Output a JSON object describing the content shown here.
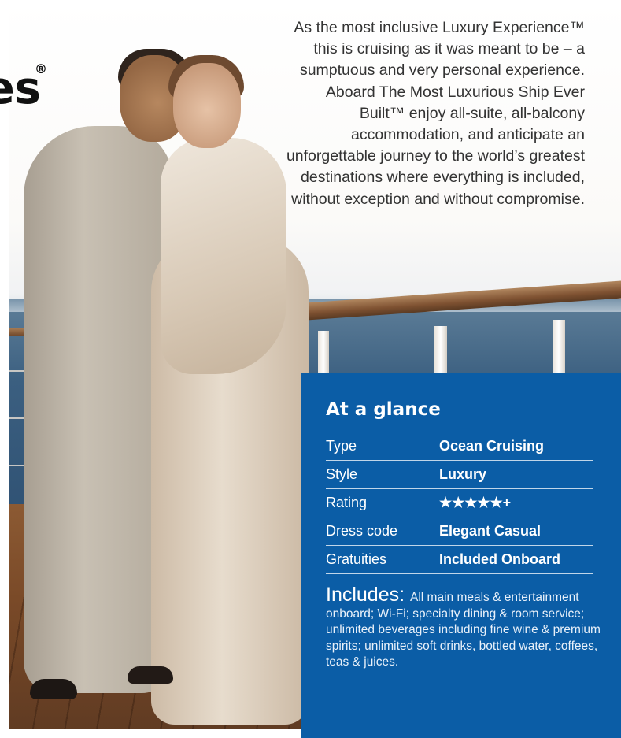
{
  "brand": {
    "partial_heading": "es",
    "registered_mark": "®"
  },
  "intro": {
    "text": "As the most inclusive Luxury Experience™ this is cruising as it was meant to be – a sumptuous and very personal experience. Aboard The Most Luxurious Ship Ever Built™ enjoy all-suite, all-balcony accommodation, and anticipate an unforgettable journey to the world’s greatest destinations where everything is included, without exception and without compromise."
  },
  "at_a_glance": {
    "title": "At a glance",
    "rows": [
      {
        "label": "Type",
        "value": "Ocean Cruising"
      },
      {
        "label": "Style",
        "value": "Luxury"
      },
      {
        "label": "Rating",
        "value": "★★★★★+"
      },
      {
        "label": "Dress code",
        "value": "Elegant Casual"
      },
      {
        "label": "Gratuities",
        "value": "Included Onboard"
      }
    ],
    "includes_label": "Includes:",
    "includes_text": "All main meals & entertainment onboard; Wi-Fi; specialty dining & room service; unlimited beverages including fine wine & premium spirits; unlimited soft drinks, bottled water, coffees, teas & juices."
  },
  "colors": {
    "panel_background": "#0b5da6",
    "intro_text": "#333333"
  }
}
